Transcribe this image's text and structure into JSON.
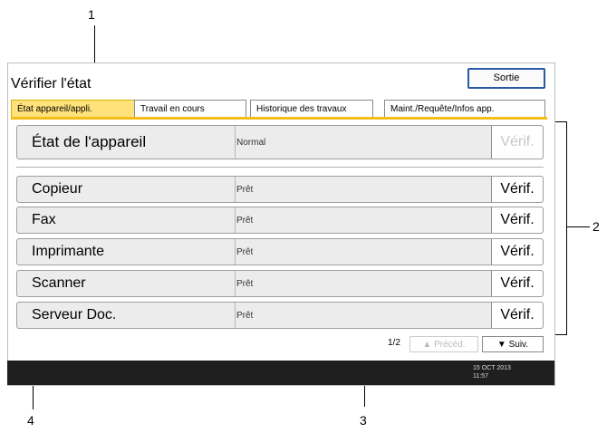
{
  "callouts": [
    "1",
    "2",
    "3",
    "4"
  ],
  "title": "Vérifier l'état",
  "exit_label": "Sortie",
  "tabs": [
    {
      "label": "État appareil/appli."
    },
    {
      "label": "Travail en cours"
    },
    {
      "label": "Historique des travaux"
    },
    {
      "label": "Maint./Requête/Infos app."
    }
  ],
  "machine": {
    "name": "État de l'appareil",
    "status": "Normal",
    "verif": "Vérif."
  },
  "functions": [
    {
      "name": "Copieur",
      "status": "Prêt",
      "verif": "Vérif."
    },
    {
      "name": "Fax",
      "status": "Prêt",
      "verif": "Vérif."
    },
    {
      "name": "Imprimante",
      "status": "Prêt",
      "verif": "Vérif."
    },
    {
      "name": "Scanner",
      "status": "Prêt",
      "verif": "Vérif."
    },
    {
      "name": "Serveur Doc.",
      "status": "Prêt",
      "verif": "Vérif."
    }
  ],
  "pager": {
    "page": "1/2",
    "prev": "▲ Précéd.",
    "next": "▼ Suiv."
  },
  "datetime": {
    "date": "15 OCT  2013",
    "time": "11:57"
  }
}
